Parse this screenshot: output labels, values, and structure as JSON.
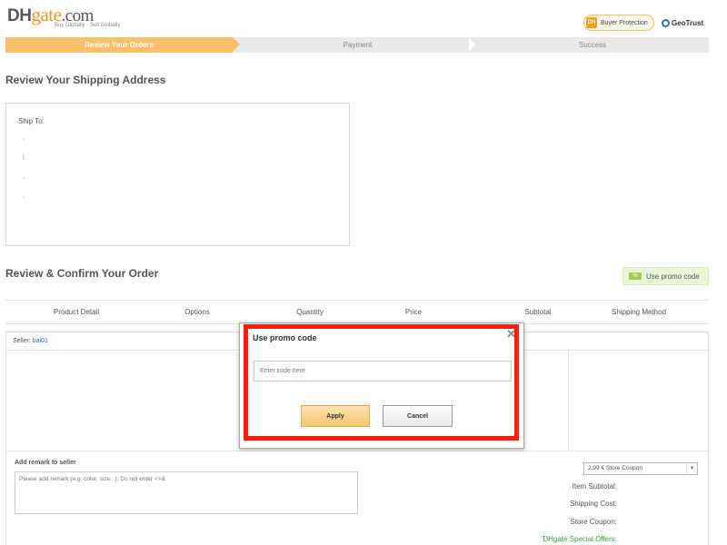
{
  "header": {
    "logo_dh": "DH",
    "logo_gate": "gate",
    "logo_com": ".com",
    "logo_tagline": "Buy Globally · Sell Globally",
    "buyer_protection_icon": "DH",
    "buyer_protection": "Buyer Protection",
    "geotrust": "GeoTrust"
  },
  "steps": [
    "Review Your Orders",
    "Payment",
    "Success"
  ],
  "shipping": {
    "title": "Review Your Shipping Address",
    "ship_to": "Ship To:",
    "lines": [
      ",",
      "|",
      ",",
      ","
    ]
  },
  "order": {
    "title": "Review & Confirm Your Order",
    "promo_button": "Use promo code",
    "promo_icon": "%",
    "columns": [
      "Product Detail",
      "Options",
      "Quantity",
      "Price",
      "Subtotal",
      "Shipping Method"
    ],
    "seller_label": "Seller:",
    "seller_name": "bai01",
    "remark_label": "Add remark to seller",
    "remark_placeholder": "Please add remark (e.g. color, size...), Do not enter <>&",
    "coupon_selected": "2,99 € Store Coupon",
    "summary": [
      "Item Subtotal:",
      "Shipping Cost:",
      "Store Coupon:",
      "DHgate Special Offers:"
    ]
  },
  "modal": {
    "title": "Use promo code",
    "input_placeholder": "Enter code here",
    "apply": "Apply",
    "cancel": "Cancel",
    "close_symbol": "✕"
  },
  "colors": {
    "accent": "#f8c069",
    "highlight": "#ff1a0a",
    "link": "#2a6ac8",
    "offer_green": "#3aa23a"
  }
}
